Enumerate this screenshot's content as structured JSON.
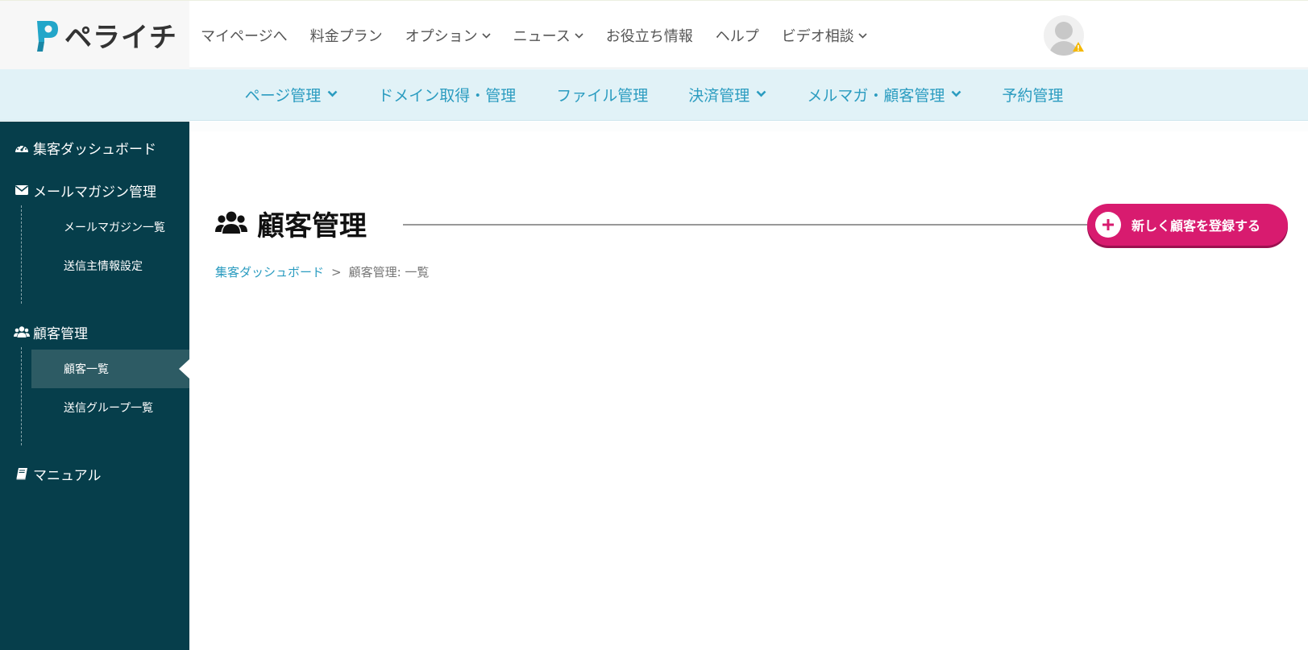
{
  "header": {
    "logo_text": "ペライチ",
    "nav": [
      {
        "label": "マイページへ",
        "has_dropdown": false
      },
      {
        "label": "料金プラン",
        "has_dropdown": false
      },
      {
        "label": "オプション",
        "has_dropdown": true
      },
      {
        "label": "ニュース",
        "has_dropdown": true
      },
      {
        "label": "お役立ち情報",
        "has_dropdown": false
      },
      {
        "label": "ヘルプ",
        "has_dropdown": false
      },
      {
        "label": "ビデオ相談",
        "has_dropdown": true
      }
    ],
    "avatar_icon": "user-avatar-icon",
    "warning_icon": "warning-icon"
  },
  "subnav": {
    "items": [
      {
        "label": "ページ管理",
        "has_dropdown": true
      },
      {
        "label": "ドメイン取得・管理",
        "has_dropdown": false
      },
      {
        "label": "ファイル管理",
        "has_dropdown": false
      },
      {
        "label": "決済管理",
        "has_dropdown": true
      },
      {
        "label": "メルマガ・顧客管理",
        "has_dropdown": true
      },
      {
        "label": "予約管理",
        "has_dropdown": false
      }
    ]
  },
  "sidebar": {
    "dashboard": {
      "label": "集客ダッシュボード",
      "icon": "dashboard-icon"
    },
    "mail": {
      "label": "メールマガジン管理",
      "icon": "envelope-icon",
      "items": [
        {
          "label": "メールマガジン一覧"
        },
        {
          "label": "送信主情報設定"
        }
      ]
    },
    "customers": {
      "label": "顧客管理",
      "icon": "users-icon",
      "items": [
        {
          "label": "顧客一覧",
          "active": true
        },
        {
          "label": "送信グループ一覧",
          "active": false
        }
      ]
    },
    "manual": {
      "label": "マニュアル",
      "icon": "book-icon"
    }
  },
  "main": {
    "title": "顧客管理",
    "title_icon": "users-icon",
    "add_button_label": "新しく顧客を登録する",
    "breadcrumb": {
      "link": "集客ダッシュボード",
      "separator": ">",
      "current": "顧客管理: 一覧"
    }
  },
  "colors": {
    "accent": "#2b9cc0",
    "sidebar_bg": "#063e4b",
    "button": "#d81b6f",
    "subnav_bg": "#e1f2f7"
  }
}
